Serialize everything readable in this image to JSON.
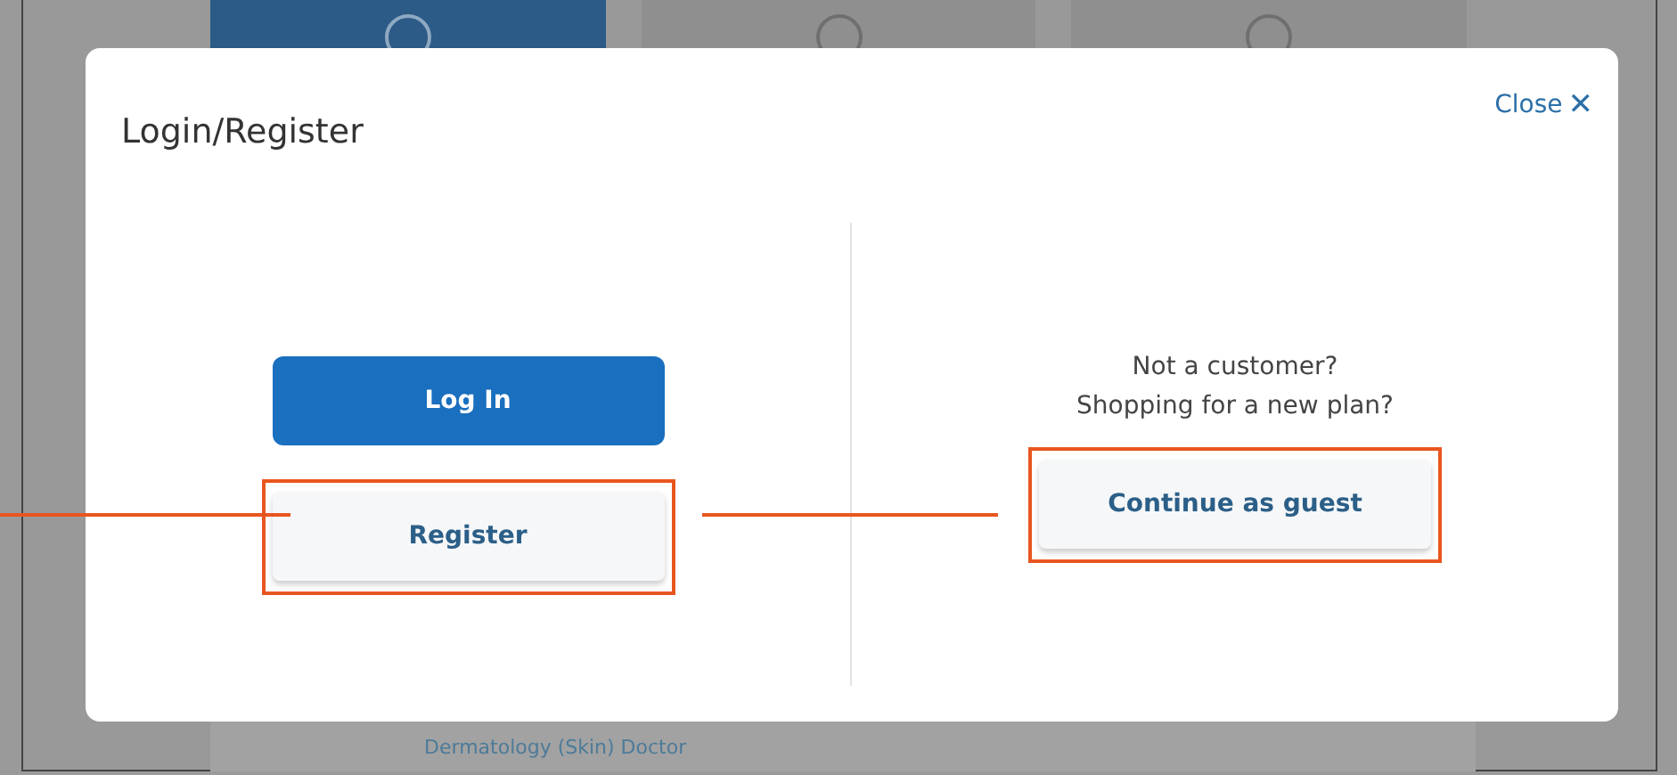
{
  "background": {
    "tabs": [
      {
        "selected": true
      },
      {
        "selected": false
      },
      {
        "selected": false
      }
    ],
    "link": "Dermatology (Skin) Doctor"
  },
  "dialog": {
    "title": "Login/Register",
    "close": "Close",
    "close_icon": "✕",
    "login_button": {
      "label": "Log In",
      "highlighted": false
    },
    "register_button": {
      "label": "Register",
      "highlighted": true
    },
    "guest_prompt": [
      "Not a customer?",
      "Shopping for a new plan?"
    ],
    "guest_button": {
      "label": "Continue as guest",
      "highlighted": true
    }
  }
}
